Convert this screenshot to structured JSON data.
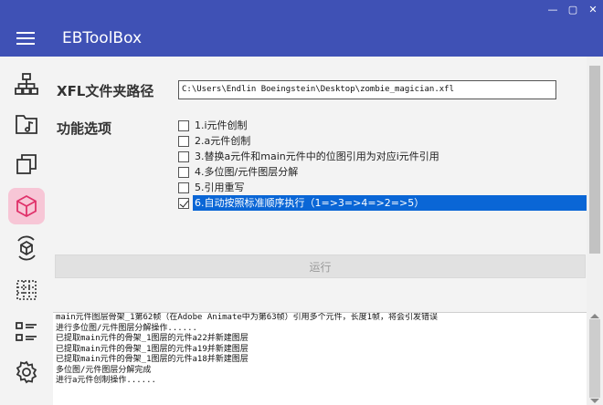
{
  "window": {
    "minimize": "—",
    "maximize": "▢",
    "close": "✕"
  },
  "app": {
    "title": "EBToolBox"
  },
  "sidebar": {
    "items": [
      {
        "icon": "hierarchy-icon"
      },
      {
        "icon": "music-folder-icon"
      },
      {
        "icon": "copy-icon"
      },
      {
        "icon": "cube-icon",
        "active": true
      },
      {
        "icon": "cube-refresh-icon"
      },
      {
        "icon": "dotted-grid-icon"
      },
      {
        "icon": "list-icon"
      },
      {
        "icon": "gear-icon"
      }
    ],
    "active_color": "#f7c6d6",
    "icon_color": "#333333",
    "active_icon_color": "#e0316a"
  },
  "main": {
    "xfl_label": "XFL文件夹路径",
    "xfl_path": "C:\\Users\\Endlin Boeingstein\\Desktop\\zombie_magician.xfl",
    "options_label": "功能选项",
    "options": [
      {
        "label": "1.i元件创制",
        "checked": false
      },
      {
        "label": "2.a元件创制",
        "checked": false
      },
      {
        "label": "3.替换a元件和main元件中的位图引用为对应i元件引用",
        "checked": false
      },
      {
        "label": "4.多位图/元件图层分解",
        "checked": false
      },
      {
        "label": "5.引用重写",
        "checked": false
      },
      {
        "label": "6.自动按照标准顺序执行（1=>3=>4=>2=>5）",
        "checked": true,
        "selected": true
      }
    ],
    "run_button": "运行",
    "log_lines": [
      "main元件图层骨架_1第62帧（在Adobe Animate中为第63帧）引用多个元件，长度1帧，将会引发错误",
      "进行多位图/元件图层分解操作......",
      "已提取main元件的骨架_1图层的元件a22并新建图层",
      "已提取main元件的骨架_1图层的元件a19并新建图层",
      "已提取main元件的骨架_1图层的元件a18并新建图层",
      "多位图/元件图层分解完成",
      "进行a元件创制操作......"
    ]
  },
  "colors": {
    "header": "#3f51b5",
    "selection": "#0a66d6"
  }
}
